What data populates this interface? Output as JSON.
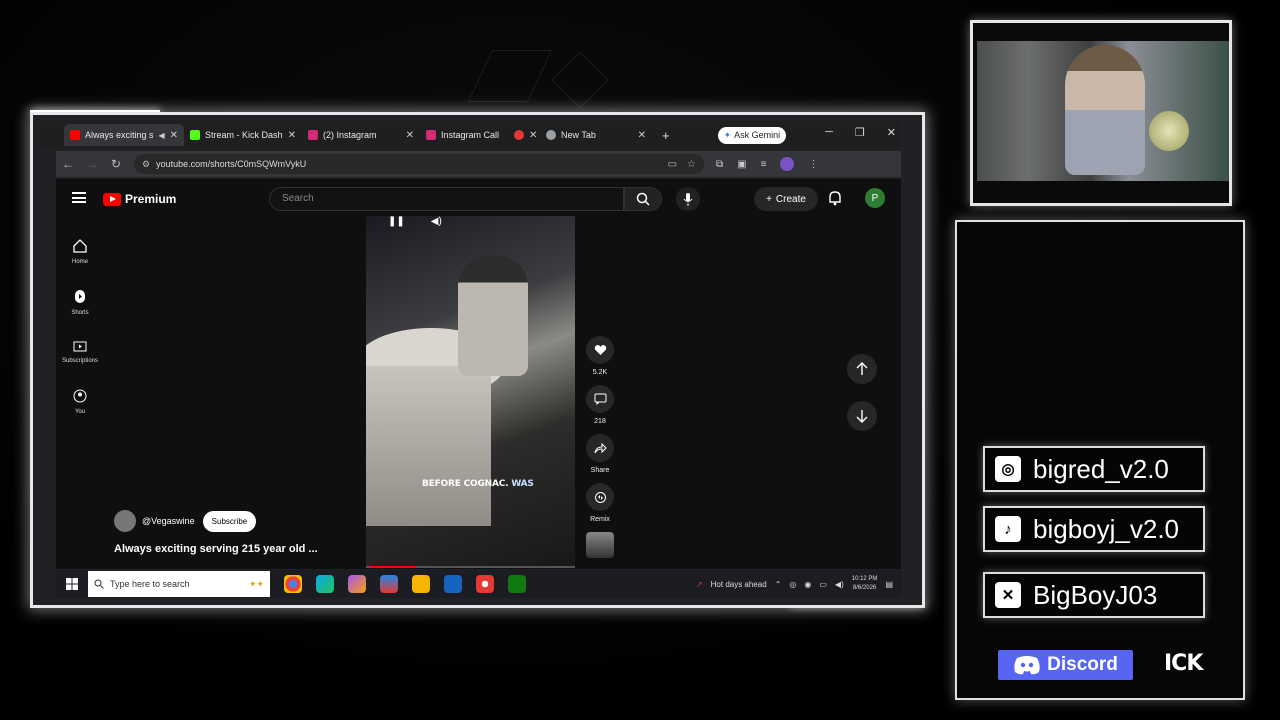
{
  "browser": {
    "tabs": [
      {
        "title": "Always exciting s",
        "favicon_color": "#ff0000",
        "active": true
      },
      {
        "title": "Stream - Kick Dashbo",
        "favicon_color": "#53fc18",
        "active": false
      },
      {
        "title": "(2) Instagram",
        "favicon_color": "#d62976",
        "active": false
      },
      {
        "title": "Instagram Call",
        "favicon_color": "#d62976",
        "active": false
      },
      {
        "title": "",
        "favicon_color": "#e53935",
        "active": false
      },
      {
        "title": "New Tab",
        "favicon_color": "#9aa0a6",
        "active": false
      }
    ],
    "new_tab": "+",
    "ask_gemini": "Ask Gemini",
    "url": "youtube.com/shorts/C0mSQWmVykU"
  },
  "youtube": {
    "brand": "Premium",
    "search_placeholder": "Search",
    "create_label": "Create",
    "avatar_letter": "P",
    "sidebar": [
      {
        "label": "Home",
        "icon": "home-icon"
      },
      {
        "label": "Shorts",
        "icon": "shorts-icon"
      },
      {
        "label": "Subscriptions",
        "icon": "subscriptions-icon"
      },
      {
        "label": "You",
        "icon": "you-icon"
      }
    ],
    "video": {
      "caption_white": "BEFORE COGNAC.",
      "caption_highlight": "WAS",
      "progress_fraction": 0.22
    },
    "actions": {
      "likes": "5.2K",
      "comments": "218",
      "share": "Share",
      "remix": "Remix"
    },
    "channel": "@Vegaswine",
    "subscribe": "Subscribe",
    "title": "Always exciting serving 215 year old ..."
  },
  "taskbar": {
    "search_placeholder": "Type here to search",
    "weather": "Hot days ahead",
    "time": "10:12 PM",
    "date": "8/6/2026"
  },
  "socials": [
    {
      "icon": "instagram-icon",
      "handle": "bigred_v2.0"
    },
    {
      "icon": "tiktok-icon",
      "handle": "bigboyj_v2.0"
    },
    {
      "icon": "x-icon",
      "handle": "BigBoyJ03"
    }
  ],
  "discord_label": "Discord",
  "kick_label": "ICK",
  "colors": {
    "youtube_red": "#ff0000",
    "discord": "#5865f2",
    "avatar_green": "#2e7d32"
  }
}
